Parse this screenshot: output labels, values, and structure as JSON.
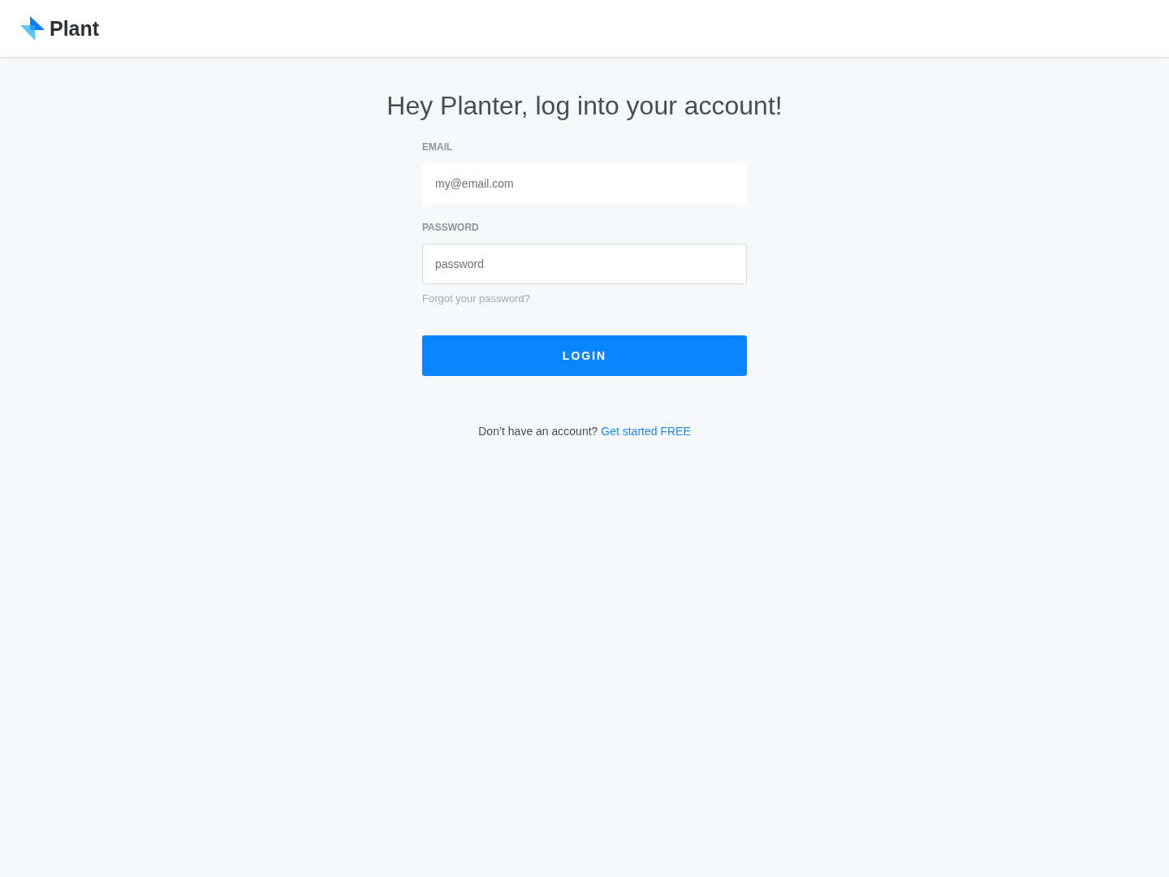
{
  "header": {
    "logo_text": "Plant"
  },
  "heading": "Hey Planter, log into your account!",
  "fields": [
    {
      "label": "EMAIL",
      "placeholder": "my@email.com",
      "bordered": false
    },
    {
      "label": "PASSWORD",
      "placeholder": "password",
      "bordered": true
    }
  ],
  "forgot_link": "Forgot your password?",
  "login_button": "LOGIN",
  "signup_prompt": {
    "text": "Don’t have an account?",
    "link": "Get started FREE"
  }
}
